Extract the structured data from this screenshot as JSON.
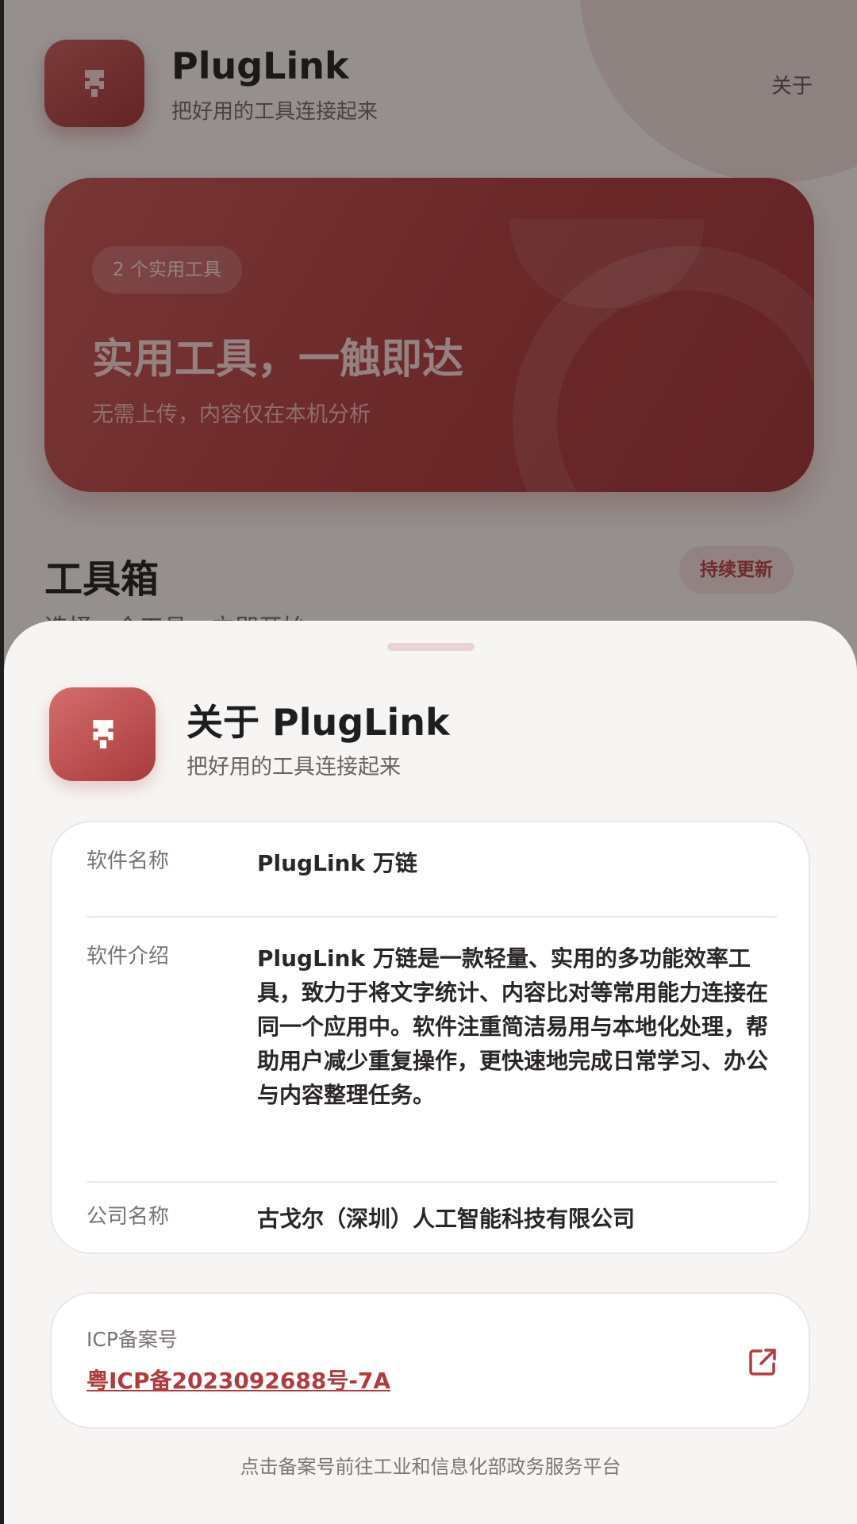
{
  "colors": {
    "brand": "#b33b3d",
    "brand_dark": "#9b2e31",
    "sheet_background": "#f7f5f4",
    "card_background": "#ffffff"
  },
  "app": {
    "name": "PlugLink",
    "tagline": "把好用的工具连接起来",
    "logo_icon": "plug-icon",
    "about_label": "关于"
  },
  "hero": {
    "badge": "2 个实用工具",
    "title": "实用工具，一触即达",
    "subtitle": "无需上传，内容仅在本机分析"
  },
  "toolbox": {
    "title": "工具箱",
    "badge": "持续更新",
    "subtitle": "选择一个工具，立即开始"
  },
  "about_sheet": {
    "title": "关于 PlugLink",
    "subtitle": "把好用的工具连接起来",
    "info": {
      "software_name_label": "软件名称",
      "software_name": "PlugLink 万链",
      "intro_label": "软件介绍",
      "intro": "PlugLink 万链是一款轻量、实用的多功能效率工具，致力于将文字统计、内容比对等常用能力连接在同一个应用中。软件注重简洁易用与本地化处理，帮助用户减少重复操作，更快速地完成日常学习、办公与内容整理任务。",
      "company_label": "公司名称",
      "company": "古戈尔（深圳）人工智能科技有限公司"
    },
    "icp": {
      "label": "ICP备案号",
      "number": "粤ICP备2023092688号-7A",
      "icon": "external-link-icon"
    },
    "footer_note": "点击备案号前往工业和信息化部政务服务平台"
  }
}
